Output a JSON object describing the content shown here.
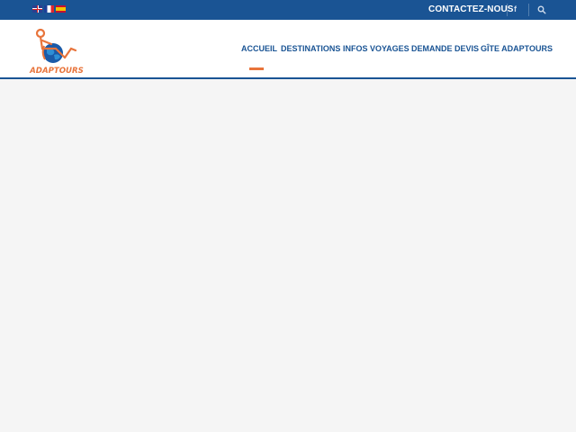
{
  "topbar": {
    "languages": [
      "english-flag-icon",
      "french-flag-icon",
      "spanish-flag-icon"
    ],
    "contact_label": "CONTACTEZ-NOUS",
    "social_icon": "f"
  },
  "nav": {
    "items": [
      {
        "label": "ACCUEIL",
        "active": true
      },
      {
        "label": "DESTINATIONS"
      },
      {
        "label": "INFOS VOYAGES"
      },
      {
        "label": "DEMANDE DEVIS"
      },
      {
        "label": "GÎTE ADAPTOURS"
      }
    ]
  },
  "logo": {
    "text": "ADAPTOURS"
  },
  "colors": {
    "brand_blue": "#1a5494",
    "accent_orange": "#e8743b",
    "background": "#f5f5f5"
  }
}
